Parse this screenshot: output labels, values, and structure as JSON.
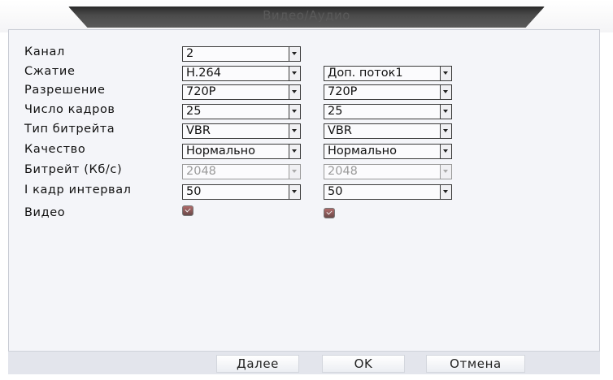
{
  "window": {
    "title": "Видео/Аудио"
  },
  "rows": {
    "channel": {
      "label": "Канал",
      "main": "2"
    },
    "compression": {
      "label": "Сжатие",
      "main": "H.264",
      "extra": "Доп. поток1"
    },
    "resolution": {
      "label": "Разрешение",
      "main": "720P",
      "extra": "720P"
    },
    "framerate": {
      "label": "Число кадров",
      "main": "25",
      "extra": "25"
    },
    "bitrate_type": {
      "label": "Тип битрейта",
      "main": "VBR",
      "extra": "VBR"
    },
    "quality": {
      "label": "Качество",
      "main": "Нормально",
      "extra": "Нормально"
    },
    "bitrate": {
      "label": "Битрейт (Кб/с)",
      "main": "2048",
      "extra": "2048"
    },
    "iframe_interval": {
      "label": "I кадр интервал",
      "main": "50",
      "extra": "50"
    },
    "video": {
      "label": "Видео",
      "main_checked": true,
      "extra_checked": true
    }
  },
  "buttons": {
    "next": "Далее",
    "ok": "OK",
    "cancel": "Отмена"
  },
  "colors": {
    "dialog_bg": "#f4f5f9",
    "title_tab": "#3a3a3a",
    "footer_bg": "#e3e5ec"
  }
}
